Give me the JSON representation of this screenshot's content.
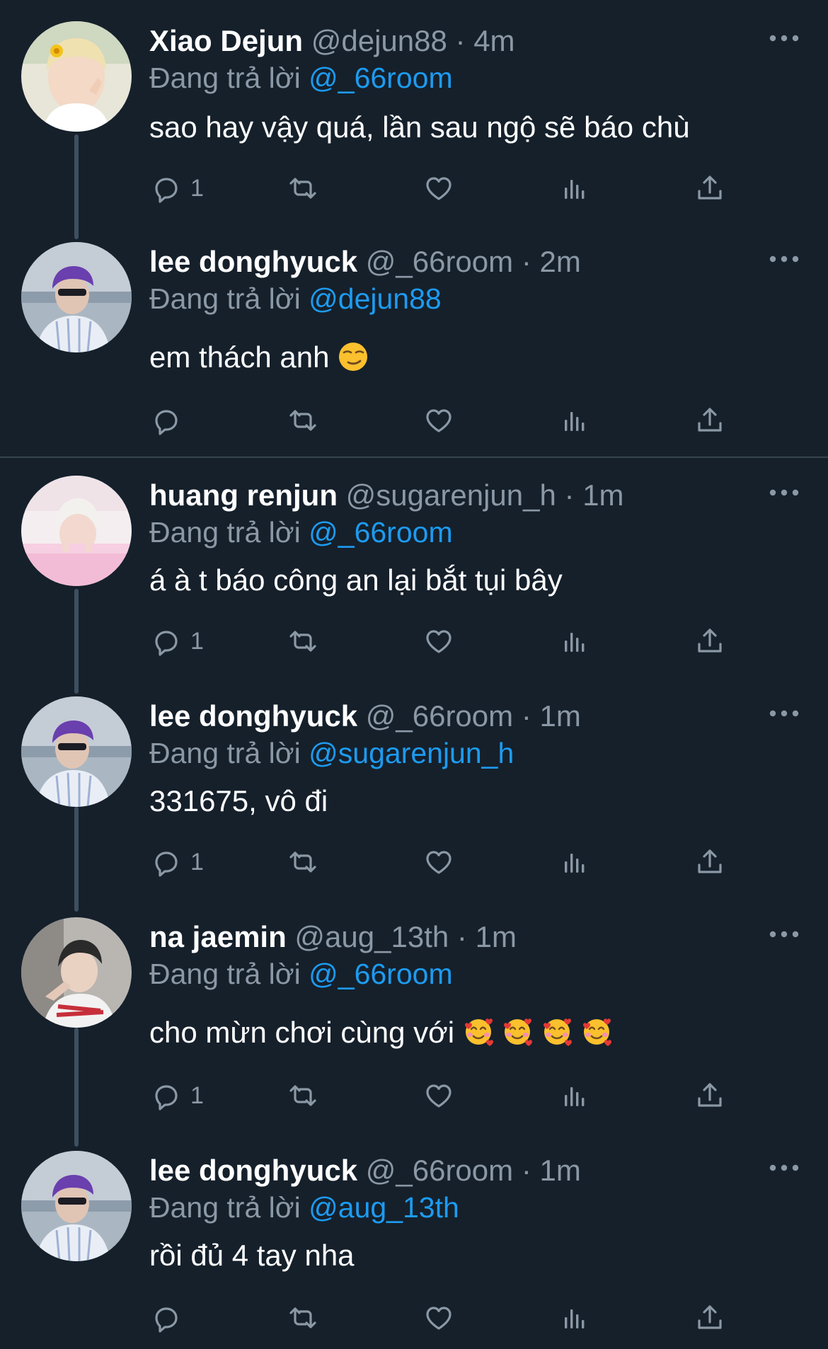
{
  "colors": {
    "background": "#15202b",
    "name": "#ffffff",
    "secondary": "#8b98a5",
    "mention": "#1d9bf0",
    "thread_line": "#3d4f60",
    "divider": "#38444d"
  },
  "replying_label": "Đang trả lời",
  "tweets": [
    {
      "name": "Xiao Dejun",
      "handle": "@dejun88",
      "sep": "·",
      "time": "4m",
      "reply_to": "@_66room",
      "text": "sao hay vậy quá, lần sau ngộ sẽ báo chù",
      "reply_count": "1",
      "avatar": "avatar-xiao-dejun"
    },
    {
      "name": "lee donghyuck",
      "handle": "@_66room",
      "sep": "·",
      "time": "2m",
      "reply_to": "@dejun88",
      "text": "em thách anh",
      "emoji": "smirking-face-emoji",
      "reply_count": "",
      "avatar": "avatar-lee-donghyuck"
    },
    {
      "name": "huang renjun",
      "handle": "@sugarenjun_h",
      "sep": "·",
      "time": "1m",
      "reply_to": "@_66room",
      "text": "á à t báo công an lại bắt tụi bây",
      "reply_count": "1",
      "avatar": "avatar-huang-renjun"
    },
    {
      "name": "lee donghyuck",
      "handle": "@_66room",
      "sep": "·",
      "time": "1m",
      "reply_to": "@sugarenjun_h",
      "text": "331675, vô đi",
      "reply_count": "1",
      "avatar": "avatar-lee-donghyuck"
    },
    {
      "name": "na jaemin",
      "handle": "@aug_13th",
      "sep": "·",
      "time": "1m",
      "reply_to": "@_66room",
      "text": "cho mừn chơi cùng với",
      "emoji": "smiling-face-with-hearts-emoji x4",
      "reply_count": "1",
      "avatar": "avatar-na-jaemin"
    },
    {
      "name": "lee donghyuck",
      "handle": "@_66room",
      "sep": "·",
      "time": "1m",
      "reply_to": "@aug_13th",
      "text": "rồi đủ 4 tay nha",
      "reply_count": "",
      "avatar": "avatar-lee-donghyuck"
    }
  ],
  "icons": {
    "reply": "reply-icon",
    "retweet": "retweet-icon",
    "like": "like-icon",
    "views": "views-icon",
    "share": "share-icon",
    "more": "more-icon"
  }
}
